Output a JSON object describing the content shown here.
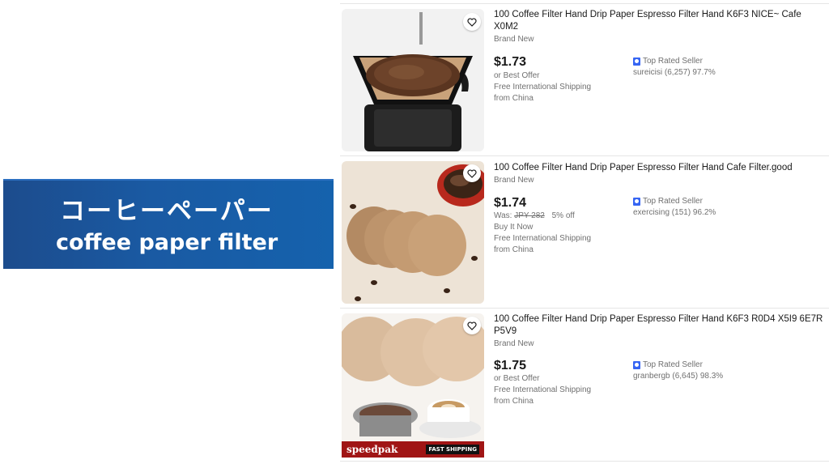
{
  "banner": {
    "japanese_title": "コーヒーペーパー",
    "english_title": "coffee paper filter"
  },
  "listings": [
    {
      "title": "100 Coffee Filter Hand Drip Paper Espresso Filter Hand K6F3 NICE~ Cafe X0M2",
      "condition": "Brand New",
      "price": "$1.73",
      "lines": [
        "or Best Offer",
        "Free International Shipping",
        "from China"
      ],
      "seller_badge": "Top Rated Seller",
      "seller": "sureicisi (6,257) 97.7%"
    },
    {
      "title": "100 Coffee Filter Hand Drip Paper Espresso Filter Hand Cafe Filter.good",
      "condition": "Brand New",
      "price": "$1.74",
      "was_label": "Was:",
      "was_price": "JPY 282",
      "discount": "5% off",
      "lines": [
        "Buy It Now",
        "Free International Shipping",
        "from China"
      ],
      "seller_badge": "Top Rated Seller",
      "seller": "exercising (151) 96.2%"
    },
    {
      "title": "100 Coffee Filter Hand Drip Paper Espresso Filter Hand K6F3 R0D4 X5I9 6E7R P5V9",
      "condition": "Brand New",
      "price": "$1.75",
      "lines": [
        "or Best Offer",
        "Free International Shipping",
        "from China"
      ],
      "seller_badge": "Top Rated Seller",
      "seller": "granbergb (6,645) 98.3%",
      "image_banner": "speedpak",
      "image_banner_tag": "FAST SHIPPING"
    }
  ],
  "icons": {
    "watch": "heart-icon",
    "seller_badge": "top-rated-seller-icon"
  },
  "colors": {
    "banner_blue": "#1a5aa3",
    "badge_blue": "#3665f3",
    "text_primary": "#191919",
    "text_secondary": "#707070"
  }
}
